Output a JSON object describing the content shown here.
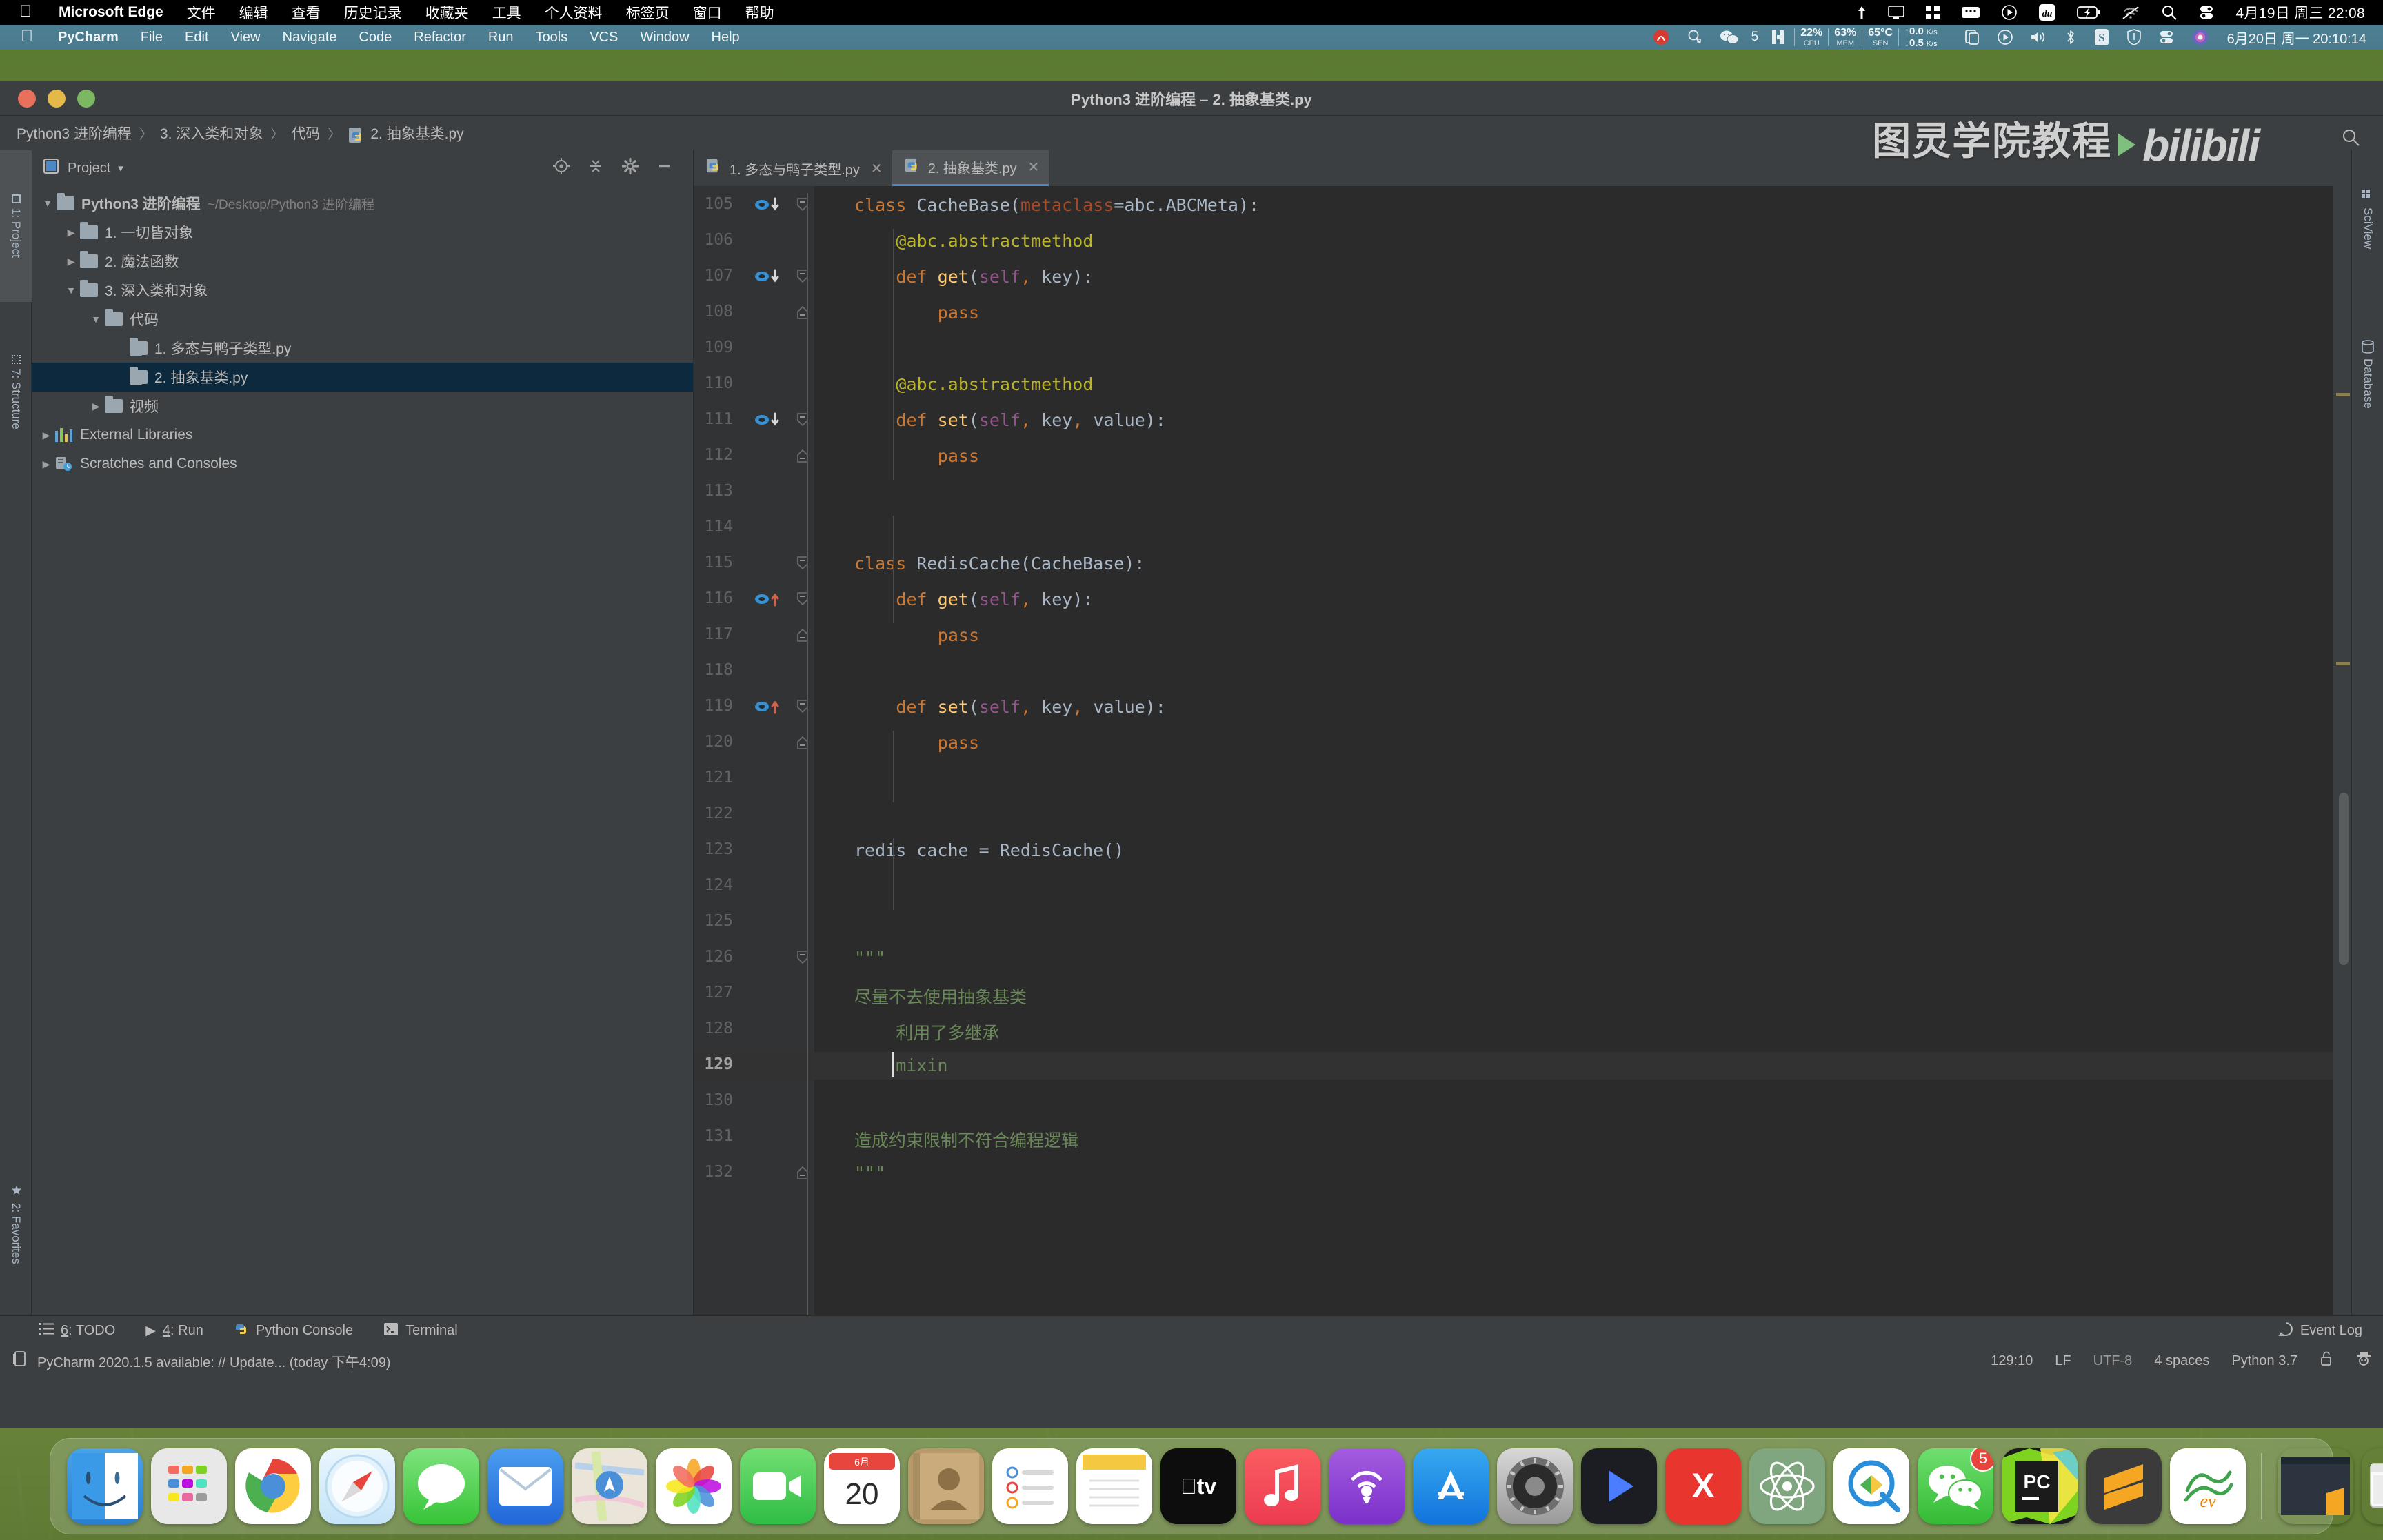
{
  "mac_menubar": {
    "app": "Microsoft Edge",
    "items": [
      "文件",
      "编辑",
      "查看",
      "历史记录",
      "收藏夹",
      "工具",
      "个人资料",
      "标签页",
      "窗口",
      "帮助"
    ],
    "tray_icons": [
      "upload-icon",
      "display-icon",
      "grid-icon",
      "keyboard-icon",
      "play-circle-icon",
      "baidu-icon",
      "battery-charging-icon",
      "wifi-off-icon",
      "search-icon",
      "control-center-icon"
    ],
    "clock": "4月19日 周三  22:08"
  },
  "pycharm_menubar": {
    "app": "PyCharm",
    "items": [
      "File",
      "Edit",
      "View",
      "Navigate",
      "Code",
      "Refactor",
      "Run",
      "Tools",
      "VCS",
      "Window",
      "Help"
    ],
    "tray": {
      "wechat_badge": "5",
      "cpu_value": "22%",
      "cpu_label": "CPU",
      "mem_value": "63%",
      "mem_label": "MEM",
      "sen_value": "65°C",
      "sen_label": "SEN",
      "net_up": "0.0",
      "net_up_unit": "K/s",
      "net_down": "0.5",
      "net_down_unit": "K/s",
      "icons": [
        "netease-music-icon",
        "magnifier-icon",
        "wechat-icon",
        "column-icon",
        "airdrop-icon",
        "play-circle-icon",
        "volume-icon",
        "bluetooth-icon",
        "sogou-input-icon",
        "shield-icon",
        "control-center-icon",
        "siri-icon"
      ]
    },
    "clock": "6月20日 周一  20:10:14"
  },
  "window": {
    "title": "Python3 进阶编程 – 2. 抽象基类.py"
  },
  "breadcrumb": {
    "items": [
      "Python3 进阶编程",
      "3. 深入类和对象",
      "代码",
      "2. 抽象基类.py"
    ],
    "separator": "〉"
  },
  "watermark": {
    "text": "图灵学院教程",
    "brand": "bilibili"
  },
  "project_panel": {
    "title": "Project",
    "caret": "▾",
    "header_icons": [
      "locate-icon",
      "collapse-all-icon",
      "settings-gear-icon",
      "hide-icon"
    ],
    "tree": [
      {
        "label": "Python3 进阶编程",
        "path": "~/Desktop/Python3 进阶编程",
        "indent": 0,
        "arrow": "▼",
        "type": "folder",
        "bold": true,
        "selected": false
      },
      {
        "label": "1. 一切皆对象",
        "path": "",
        "indent": 1,
        "arrow": "▶",
        "type": "folder",
        "bold": false,
        "selected": false
      },
      {
        "label": "2. 魔法函数",
        "path": "",
        "indent": 1,
        "arrow": "▶",
        "type": "folder",
        "bold": false,
        "selected": false
      },
      {
        "label": "3. 深入类和对象",
        "path": "",
        "indent": 1,
        "arrow": "▼",
        "type": "folder",
        "bold": false,
        "selected": false
      },
      {
        "label": "代码",
        "path": "",
        "indent": 2,
        "arrow": "▼",
        "type": "folder",
        "bold": false,
        "selected": false
      },
      {
        "label": "1. 多态与鸭子类型.py",
        "path": "",
        "indent": 3,
        "arrow": "",
        "type": "python",
        "bold": false,
        "selected": false
      },
      {
        "label": "2. 抽象基类.py",
        "path": "",
        "indent": 3,
        "arrow": "",
        "type": "python",
        "bold": false,
        "selected": true
      },
      {
        "label": "视频",
        "path": "",
        "indent": 2,
        "arrow": "▶",
        "type": "folder",
        "bold": false,
        "selected": false
      },
      {
        "label": "External Libraries",
        "path": "",
        "indent": 0,
        "arrow": "▶",
        "type": "libs",
        "bold": false,
        "selected": false
      },
      {
        "label": "Scratches and Consoles",
        "path": "",
        "indent": 0,
        "arrow": "▶",
        "type": "scratch",
        "bold": false,
        "selected": false
      }
    ]
  },
  "left_strip": [
    {
      "label": "1: Project",
      "active": true
    },
    {
      "label": "7: Structure",
      "active": false
    },
    {
      "label": "2: Favorites",
      "active": false
    }
  ],
  "right_strip": [
    {
      "label": "SciView",
      "active": false
    },
    {
      "label": "Database",
      "active": false
    }
  ],
  "editor_tabs": [
    {
      "label": "1. 多态与鸭子类型.py",
      "active": false,
      "close": "✕"
    },
    {
      "label": "2. 抽象基类.py",
      "active": true,
      "close": "✕"
    }
  ],
  "code": {
    "first_line_number": 105,
    "current_line": 129,
    "lines": [
      {
        "n": 105,
        "marker": "run-down",
        "fold": "fold-open",
        "indent": 0,
        "tokens": [
          {
            "t": "class ",
            "c": "kw"
          },
          {
            "t": "CacheBase",
            "c": "cls"
          },
          {
            "t": "(",
            "c": "punc"
          },
          {
            "t": "metaclass",
            "c": "named"
          },
          {
            "t": "=",
            "c": "punc"
          },
          {
            "t": "abc",
            "c": "plain"
          },
          {
            "t": ".",
            "c": "punc"
          },
          {
            "t": "ABCMeta",
            "c": "plain"
          },
          {
            "t": "):",
            "c": "punc"
          }
        ]
      },
      {
        "n": 106,
        "marker": "",
        "fold": "",
        "indent": 1,
        "tokens": [
          {
            "t": "@abc.abstractmethod",
            "c": "dec"
          }
        ]
      },
      {
        "n": 107,
        "marker": "run-down",
        "fold": "fold-open",
        "indent": 1,
        "tokens": [
          {
            "t": "def ",
            "c": "kw"
          },
          {
            "t": "get",
            "c": "fn"
          },
          {
            "t": "(",
            "c": "punc"
          },
          {
            "t": "self",
            "c": "self"
          },
          {
            "t": ",",
            "c": "comma"
          },
          {
            "t": " key",
            "c": "param"
          },
          {
            "t": "):",
            "c": "punc"
          }
        ]
      },
      {
        "n": 108,
        "marker": "",
        "fold": "fold-end",
        "indent": 2,
        "tokens": [
          {
            "t": "pass",
            "c": "kw"
          }
        ]
      },
      {
        "n": 109,
        "marker": "",
        "fold": "",
        "indent": 0,
        "tokens": []
      },
      {
        "n": 110,
        "marker": "",
        "fold": "",
        "indent": 1,
        "tokens": [
          {
            "t": "@abc.abstractmethod",
            "c": "dec"
          }
        ]
      },
      {
        "n": 111,
        "marker": "run-down",
        "fold": "fold-open",
        "indent": 1,
        "tokens": [
          {
            "t": "def ",
            "c": "kw"
          },
          {
            "t": "set",
            "c": "fn"
          },
          {
            "t": "(",
            "c": "punc"
          },
          {
            "t": "self",
            "c": "self"
          },
          {
            "t": ",",
            "c": "comma"
          },
          {
            "t": " key",
            "c": "param"
          },
          {
            "t": ",",
            "c": "comma"
          },
          {
            "t": " value",
            "c": "param"
          },
          {
            "t": "):",
            "c": "punc"
          }
        ]
      },
      {
        "n": 112,
        "marker": "",
        "fold": "fold-end",
        "indent": 2,
        "tokens": [
          {
            "t": "pass",
            "c": "kw"
          }
        ]
      },
      {
        "n": 113,
        "marker": "",
        "fold": "",
        "indent": 0,
        "tokens": []
      },
      {
        "n": 114,
        "marker": "",
        "fold": "",
        "indent": 0,
        "tokens": []
      },
      {
        "n": 115,
        "marker": "",
        "fold": "fold-open",
        "indent": 0,
        "tokens": [
          {
            "t": "class ",
            "c": "kw"
          },
          {
            "t": "RedisCache",
            "c": "cls"
          },
          {
            "t": "(",
            "c": "punc"
          },
          {
            "t": "CacheBase",
            "c": "plain"
          },
          {
            "t": "):",
            "c": "punc"
          }
        ]
      },
      {
        "n": 116,
        "marker": "run-up",
        "fold": "fold-open",
        "indent": 1,
        "tokens": [
          {
            "t": "def ",
            "c": "kw"
          },
          {
            "t": "get",
            "c": "fn"
          },
          {
            "t": "(",
            "c": "punc"
          },
          {
            "t": "self",
            "c": "self"
          },
          {
            "t": ",",
            "c": "comma"
          },
          {
            "t": " key",
            "c": "param"
          },
          {
            "t": "):",
            "c": "punc"
          }
        ]
      },
      {
        "n": 117,
        "marker": "",
        "fold": "fold-end",
        "indent": 2,
        "tokens": [
          {
            "t": "pass",
            "c": "kw"
          }
        ]
      },
      {
        "n": 118,
        "marker": "",
        "fold": "",
        "indent": 0,
        "tokens": []
      },
      {
        "n": 119,
        "marker": "run-up",
        "fold": "fold-open",
        "indent": 1,
        "tokens": [
          {
            "t": "def ",
            "c": "kw"
          },
          {
            "t": "set",
            "c": "fn"
          },
          {
            "t": "(",
            "c": "punc"
          },
          {
            "t": "self",
            "c": "self"
          },
          {
            "t": ",",
            "c": "comma"
          },
          {
            "t": " key",
            "c": "param"
          },
          {
            "t": ",",
            "c": "comma"
          },
          {
            "t": " value",
            "c": "param"
          },
          {
            "t": "):",
            "c": "punc"
          }
        ]
      },
      {
        "n": 120,
        "marker": "",
        "fold": "fold-end",
        "indent": 2,
        "tokens": [
          {
            "t": "pass",
            "c": "kw"
          }
        ]
      },
      {
        "n": 121,
        "marker": "",
        "fold": "",
        "indent": 0,
        "tokens": []
      },
      {
        "n": 122,
        "marker": "",
        "fold": "",
        "indent": 0,
        "tokens": []
      },
      {
        "n": 123,
        "marker": "",
        "fold": "",
        "indent": 0,
        "tokens": [
          {
            "t": "redis_cache = RedisCache()",
            "c": "plain"
          }
        ]
      },
      {
        "n": 124,
        "marker": "",
        "fold": "",
        "indent": 0,
        "tokens": []
      },
      {
        "n": 125,
        "marker": "",
        "fold": "",
        "indent": 0,
        "tokens": []
      },
      {
        "n": 126,
        "marker": "",
        "fold": "fold-open",
        "indent": 0,
        "tokens": [
          {
            "t": "\"\"\"",
            "c": "str"
          }
        ]
      },
      {
        "n": 127,
        "marker": "",
        "fold": "",
        "indent": 0,
        "tokens": [
          {
            "t": "尽量不去使用抽象基类",
            "c": "str"
          }
        ]
      },
      {
        "n": 128,
        "marker": "",
        "fold": "",
        "indent": 0,
        "tokens": [
          {
            "t": "    利用了多继承",
            "c": "str"
          }
        ]
      },
      {
        "n": 129,
        "marker": "",
        "fold": "",
        "indent": 0,
        "tokens": [
          {
            "t": "    mixin",
            "c": "str"
          }
        ]
      },
      {
        "n": 130,
        "marker": "",
        "fold": "",
        "indent": 0,
        "tokens": []
      },
      {
        "n": 131,
        "marker": "",
        "fold": "",
        "indent": 0,
        "tokens": [
          {
            "t": "造成约束限制不符合编程逻辑",
            "c": "str"
          }
        ]
      },
      {
        "n": 132,
        "marker": "",
        "fold": "fold-end",
        "indent": 0,
        "tokens": [
          {
            "t": "\"\"\"",
            "c": "str"
          }
        ]
      }
    ]
  },
  "tool_strip": {
    "items": [
      {
        "icon": "todo-icon",
        "num": "6",
        "label": ": TODO"
      },
      {
        "icon": "run-icon",
        "num": "4",
        "label": ": Run"
      },
      {
        "icon": "python-icon",
        "num": "",
        "label": "Python Console"
      },
      {
        "icon": "terminal-icon",
        "num": "",
        "label": "Terminal"
      }
    ],
    "event_log": "Event Log"
  },
  "status_bar": {
    "message": "PyCharm 2020.1.5 available: // Update... (today 下午4:09)",
    "caret": "129:10",
    "line_sep": "LF",
    "encoding": "UTF-8",
    "indent": "4 spaces",
    "interpreter": "Python 3.7",
    "right_icons": [
      "lock-open-icon",
      "inspector-hat-icon"
    ]
  },
  "dock": {
    "items": [
      {
        "name": "finder",
        "glyph": "☺",
        "bg": "linear-gradient(#4aa3e8,#2a7fd0)",
        "running": true
      },
      {
        "name": "launchpad",
        "glyph": "",
        "bg": "#e8e8e8",
        "running": true
      },
      {
        "name": "chrome",
        "glyph": "",
        "bg": "#fff",
        "running": false
      },
      {
        "name": "safari",
        "glyph": "",
        "bg": "linear-gradient(#eaf6ff,#c5e4f7)",
        "running": false
      },
      {
        "name": "messages",
        "glyph": "",
        "bg": "linear-gradient(#7ee37e,#37c437)",
        "running": false
      },
      {
        "name": "mail",
        "glyph": "✉",
        "bg": "linear-gradient(#4a9ef0,#2266d8)",
        "running": false
      },
      {
        "name": "maps",
        "glyph": "",
        "bg": "#eae5d8",
        "running": false
      },
      {
        "name": "photos",
        "glyph": "",
        "bg": "#fff",
        "running": false
      },
      {
        "name": "facetime",
        "glyph": "",
        "bg": "linear-gradient(#72df72,#2fbd45)",
        "running": false
      },
      {
        "name": "calendar",
        "glyph": "20",
        "bg": "#fff",
        "running": false
      },
      {
        "name": "contacts",
        "glyph": "",
        "bg": "#b79a6a",
        "running": false
      },
      {
        "name": "reminders",
        "glyph": "",
        "bg": "#fff",
        "running": false
      },
      {
        "name": "notes",
        "glyph": "",
        "bg": "#fff",
        "running": false
      },
      {
        "name": "appletv",
        "glyph": "tv",
        "bg": "#0d0d0d",
        "running": false
      },
      {
        "name": "music",
        "glyph": "♫",
        "bg": "linear-gradient(#fb5d62,#ec3b50)",
        "running": false
      },
      {
        "name": "podcasts",
        "glyph": "",
        "bg": "linear-gradient(#a45ce0,#7b30c9)",
        "running": false
      },
      {
        "name": "appstore",
        "glyph": "A",
        "bg": "linear-gradient(#37a9ef,#1173dd)",
        "running": false
      },
      {
        "name": "system-preferences",
        "glyph": "",
        "bg": "linear-gradient(#d8d8d8,#999)",
        "running": false
      },
      {
        "name": "iina",
        "glyph": "▶",
        "bg": "#1b1d22",
        "running": true
      },
      {
        "name": "xmind",
        "glyph": "X",
        "bg": "#e8352e",
        "running": true
      },
      {
        "name": "atom",
        "glyph": "",
        "bg": "#7fa67f",
        "running": true
      },
      {
        "name": "qq",
        "glyph": "",
        "bg": "#fff",
        "running": true
      },
      {
        "name": "wechat",
        "glyph": "",
        "bg": "linear-gradient(#6fdf6f,#34bb34)",
        "badge": "5",
        "running": true
      },
      {
        "name": "pycharm",
        "glyph": "PC",
        "bg": "#1b1b1b",
        "running": true
      },
      {
        "name": "sublime-text",
        "glyph": "S",
        "bg": "#3b3b3b",
        "running": true
      },
      {
        "name": "evernote",
        "glyph": "",
        "bg": "#fff",
        "running": true
      }
    ],
    "right_items": [
      {
        "name": "downloads-stack",
        "glyph": "",
        "bg": "#2c3440"
      },
      {
        "name": "finder-window-stack",
        "glyph": "",
        "bg": "transparent"
      },
      {
        "name": "trash",
        "glyph": "",
        "bg": "transparent"
      }
    ]
  }
}
